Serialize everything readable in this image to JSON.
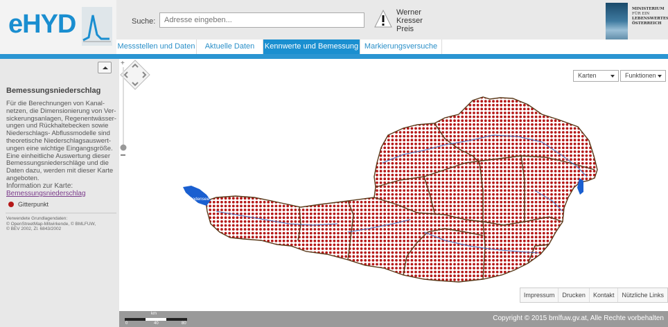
{
  "header": {
    "logo_text": "eHYD",
    "search_label": "Suche:",
    "search_placeholder": "Adresse eingeben...",
    "award_lines": [
      "Werner",
      "Kresser",
      "Preis"
    ],
    "ministry_lines": [
      "MINISTERIUM",
      "FÜR EIN",
      "LEBENSWERTES",
      "ÖSTERREICH"
    ]
  },
  "tabs": [
    {
      "label": "Messstellen und Daten"
    },
    {
      "label": "Aktuelle Daten"
    },
    {
      "label": "Kennwerte und Bemessung"
    },
    {
      "label": "Markierungsversuche"
    }
  ],
  "active_tab": "Kennwerte und Bemessung",
  "sidebar": {
    "title": "Bemessungsniederschlag",
    "body_lines": [
      "Für die Berechnungen von Kanal-",
      "netzen, die Dimensionierung von Ver-",
      "sickerungsanlagen, Regenentwässer-",
      "ungen und Rückhaltebecken sowie",
      "Niederschlags- Abflussmodelle sind",
      "theoretische Niederschlagsauswert-",
      "ungen eine wichtige Eingangsgröße.",
      "Eine einheitliche Auswertung dieser",
      "Bemessungsniederschläge und die",
      "Daten dazu, werden mit dieser Karte",
      "angeboten."
    ],
    "info_label": "Information zur Karte:",
    "info_link": "Bemessungsniederschlag",
    "legend_label": "Gitterpunkt",
    "data_lines": [
      "Verwendete Grundlagendaten:",
      "© OpenStreetMap-Mitwirkende, © BMLFUW,",
      "© BEV 2002, Zl. 6843/2002"
    ]
  },
  "map": {
    "dropdown_maps": "Karten",
    "dropdown_functions": "Funktionen",
    "lake_label": "Bodensee",
    "point_color": "#b51818",
    "footer_links": [
      "Impressum",
      "Drucken",
      "Kontakt",
      "Nützliche Links"
    ]
  },
  "bottom": {
    "scale_unit": "km",
    "scale_ticks": [
      "0",
      "40",
      "80"
    ],
    "copyright": "Copyright © 2015 bmlfuw.gv.at, Alle Rechte vorbehalten"
  },
  "colors": {
    "brand_blue": "#1a8fd0",
    "grid_point": "#b51818",
    "river": "#4a78c8",
    "boundary": "#5a3a1a"
  }
}
